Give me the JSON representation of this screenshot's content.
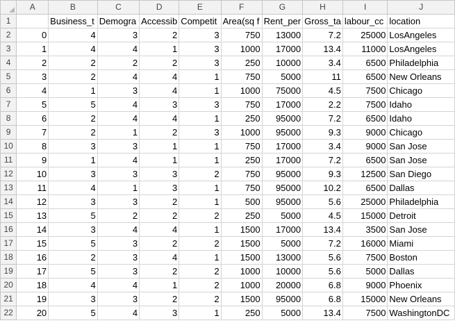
{
  "columns": [
    "A",
    "B",
    "C",
    "D",
    "E",
    "F",
    "G",
    "H",
    "I",
    "J"
  ],
  "header_row": [
    "",
    "Business_t",
    "Demogra",
    "Accessib",
    "Competit",
    "Area(sq f",
    "Rent_per",
    "Gross_ta",
    "labour_cc",
    "location"
  ],
  "rows": [
    [
      "0",
      "4",
      "3",
      "2",
      "3",
      "750",
      "13000",
      "7.2",
      "25000",
      "LosAngeles"
    ],
    [
      "1",
      "4",
      "4",
      "1",
      "3",
      "1000",
      "17000",
      "13.4",
      "11000",
      "LosAngeles"
    ],
    [
      "2",
      "2",
      "2",
      "2",
      "3",
      "250",
      "10000",
      "3.4",
      "6500",
      "Philadelphia"
    ],
    [
      "3",
      "2",
      "4",
      "4",
      "1",
      "750",
      "5000",
      "11",
      "6500",
      "New Orleans"
    ],
    [
      "4",
      "1",
      "3",
      "4",
      "1",
      "1000",
      "75000",
      "4.5",
      "7500",
      "Chicago"
    ],
    [
      "5",
      "5",
      "4",
      "3",
      "3",
      "750",
      "17000",
      "2.2",
      "7500",
      "Idaho"
    ],
    [
      "6",
      "2",
      "4",
      "4",
      "1",
      "250",
      "95000",
      "7.2",
      "6500",
      "Idaho"
    ],
    [
      "7",
      "2",
      "1",
      "2",
      "3",
      "1000",
      "95000",
      "9.3",
      "9000",
      "Chicago"
    ],
    [
      "8",
      "3",
      "3",
      "1",
      "1",
      "750",
      "17000",
      "3.4",
      "9000",
      "San Jose"
    ],
    [
      "9",
      "1",
      "4",
      "1",
      "1",
      "250",
      "17000",
      "7.2",
      "6500",
      "San Jose"
    ],
    [
      "10",
      "3",
      "3",
      "3",
      "2",
      "750",
      "95000",
      "9.3",
      "12500",
      "San Diego"
    ],
    [
      "11",
      "4",
      "1",
      "3",
      "1",
      "750",
      "95000",
      "10.2",
      "6500",
      "Dallas"
    ],
    [
      "12",
      "3",
      "3",
      "2",
      "1",
      "500",
      "95000",
      "5.6",
      "25000",
      "Philadelphia"
    ],
    [
      "13",
      "5",
      "2",
      "2",
      "2",
      "250",
      "5000",
      "4.5",
      "15000",
      "Detroit"
    ],
    [
      "14",
      "3",
      "4",
      "4",
      "1",
      "1500",
      "17000",
      "13.4",
      "3500",
      "San Jose"
    ],
    [
      "15",
      "5",
      "3",
      "2",
      "2",
      "1500",
      "5000",
      "7.2",
      "16000",
      "Miami"
    ],
    [
      "16",
      "2",
      "3",
      "4",
      "1",
      "1500",
      "13000",
      "5.6",
      "7500",
      "Boston"
    ],
    [
      "17",
      "5",
      "3",
      "2",
      "2",
      "1000",
      "10000",
      "5.6",
      "5000",
      "Dallas"
    ],
    [
      "18",
      "4",
      "4",
      "1",
      "2",
      "1000",
      "20000",
      "6.8",
      "9000",
      "Phoenix"
    ],
    [
      "19",
      "3",
      "3",
      "2",
      "2",
      "1500",
      "95000",
      "6.8",
      "15000",
      "New Orleans"
    ],
    [
      "20",
      "5",
      "4",
      "3",
      "1",
      "250",
      "5000",
      "13.4",
      "7500",
      "WashingtonDC"
    ]
  ],
  "colors": {
    "header_bg": "#f2f2f2",
    "gridline": "#d4d4d4"
  }
}
